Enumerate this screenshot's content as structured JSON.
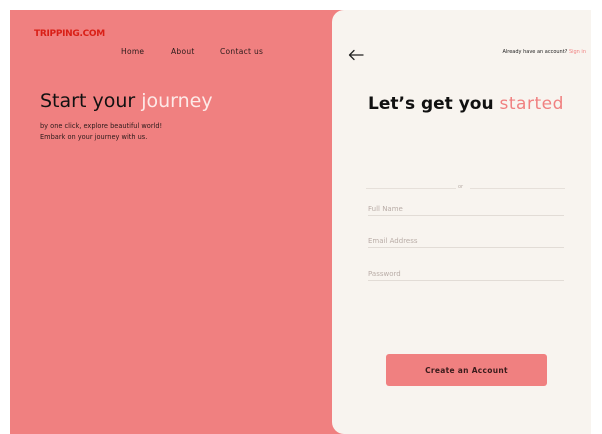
{
  "brand": {
    "logo_text": "TRIPPING.COM",
    "logo_color": "#d91f16"
  },
  "nav": {
    "items": [
      "Home",
      "About",
      "Contact us"
    ]
  },
  "hero": {
    "title_prefix": "Start your ",
    "title_highlight": "journey",
    "subtitle_line1": "by one click, explore beautiful world!",
    "subtitle_line2": "Embark on your journey with us."
  },
  "form": {
    "back_icon": "arrow-left-icon",
    "signin_prompt": "Already have an account?",
    "signin_link": "Sign in",
    "title_prefix": "Let’s get you ",
    "title_highlight": "started",
    "divider_text": "or",
    "full_name_placeholder": "Full Name",
    "email_placeholder": "Email Address",
    "password_placeholder": "Password",
    "submit_label": "Create an Account"
  },
  "colors": {
    "accent": "#f08080",
    "panel_bg": "#f8f4ef"
  }
}
